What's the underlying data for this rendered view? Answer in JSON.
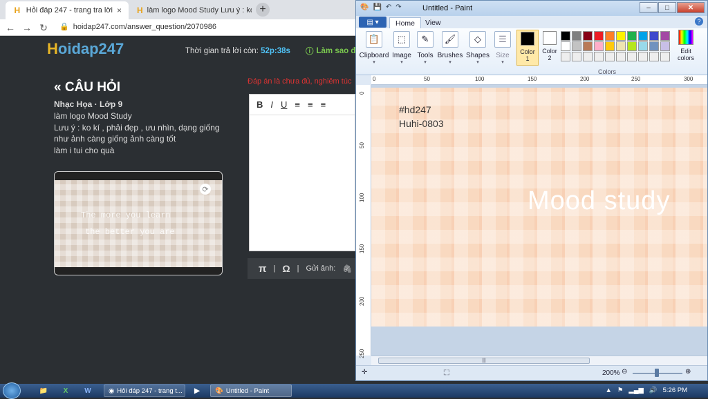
{
  "browser": {
    "tabs": [
      {
        "label": "Hỏi đáp 247 - trang tra lời",
        "close": "×"
      },
      {
        "label": "làm logo Mood Study Lưu ý : ko",
        "close": "×"
      }
    ],
    "new_tab": "+",
    "url": "hoidap247.com/answer_question/2070986"
  },
  "site": {
    "logo_h": "H",
    "logo_rest": "oidap247",
    "timer_label": "Thời gian trả lời còn:",
    "timer_value": "52p:38s",
    "help_text": "Làm sao đ",
    "question_heading": "CÂU HỎI",
    "question_meta": "Nhạc Họa · Lớp 9",
    "question_lines": [
      "làm logo Mood Study",
      "Lưu ý : ko kí , phải đẹp , ưu nhìn, dạng giống",
      "như ảnh càng giống ảnh càng tốt",
      "làm i tui cho quà"
    ],
    "image_text_1": "The more you learn",
    "image_text_2": "the better you are",
    "notice_text": "Đáp án là chưa đủ, nghiêm túc",
    "editor_tools": [
      "B",
      "I",
      "U"
    ],
    "editor_bottom": {
      "pi": "π",
      "omega": "Ω",
      "attach": "Gửi ảnh:"
    }
  },
  "paint": {
    "title": "Untitled - Paint",
    "file_menu": "▤ ▾",
    "tabs": [
      "Home",
      "View"
    ],
    "groups": [
      {
        "label": "Clipboard",
        "icon": "clipboard-icon"
      },
      {
        "label": "Image",
        "icon": "image-select-icon"
      },
      {
        "label": "Tools",
        "icon": "tools-icon"
      },
      {
        "label": "Brushes",
        "icon": "brush-icon"
      },
      {
        "label": "Shapes",
        "icon": "shapes-icon"
      },
      {
        "label": "Size",
        "icon": "size-icon"
      }
    ],
    "color1_label": "Color 1",
    "color2_label": "Color 2",
    "colors_label": "Colors",
    "edit_colors_label": "Edit colors",
    "palette": [
      "#000000",
      "#7f7f7f",
      "#880015",
      "#ed1c24",
      "#ff7f27",
      "#fff200",
      "#22b14c",
      "#00a2e8",
      "#3f48cc",
      "#a349a4",
      "#ffffff",
      "#c3c3c3",
      "#b97a57",
      "#ffaec9",
      "#ffc90e",
      "#efe4b0",
      "#b5e61d",
      "#99d9ea",
      "#7092be",
      "#c8bfe7",
      "#eeeeee",
      "#eeeeee",
      "#eeeeee",
      "#eeeeee",
      "#eeeeee",
      "#eeeeee",
      "#eeeeee",
      "#eeeeee",
      "#eeeeee",
      "#eeeeee"
    ],
    "ruler_top": [
      "0",
      "50",
      "100",
      "150",
      "200",
      "250",
      "300"
    ],
    "ruler_left": [
      "0",
      "50",
      "100",
      "150",
      "200",
      "250"
    ],
    "canvas_line_1": "#hd247",
    "canvas_line_2": "Huhi-0803",
    "canvas_big": "Mood study",
    "zoom": "200%",
    "scroll_grip": "|||"
  },
  "taskbar": {
    "tasks": [
      "Hỏi đáp 247 - trang t...",
      "Untitled - Paint"
    ],
    "clock": "5:26 PM"
  }
}
